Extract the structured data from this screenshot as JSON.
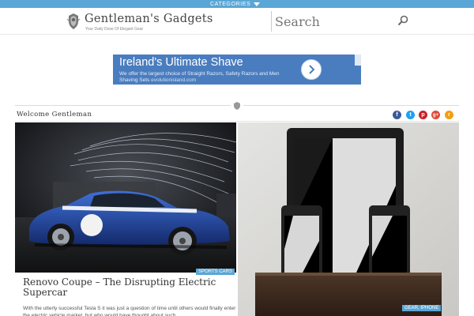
{
  "topbar": {
    "categories_label": "CATEGORIES"
  },
  "header": {
    "site_title": "Gentleman's Gadgets",
    "tagline": "Your Daily Dose Of Elegant Gear",
    "search_placeholder": "Search"
  },
  "ad": {
    "title": "Ireland's Ultimate Shave",
    "text": "We offer the largest choice of Straight Razors, Safety Razors and Men Shaving Sets",
    "url": "evolutionisland.com"
  },
  "welcome": "Welcome Gentleman",
  "social": {
    "facebook": "f",
    "twitter": "t",
    "pinterest": "p",
    "googleplus": "g+",
    "rss": "r"
  },
  "posts": [
    {
      "tag": "SPORTS CARS",
      "title": "Renovo Coupe – The Disrupting Electric Supercar",
      "excerpt": "With the utterly successful Tesla S it was just a question of time until others would finally enter the electric vehicle market, but who would have thought about such"
    },
    {
      "tags": [
        "GEAR",
        "IPHONE"
      ]
    }
  ],
  "colors": {
    "accent": "#5aa6d6",
    "ad_bg": "#4a7dbf"
  }
}
